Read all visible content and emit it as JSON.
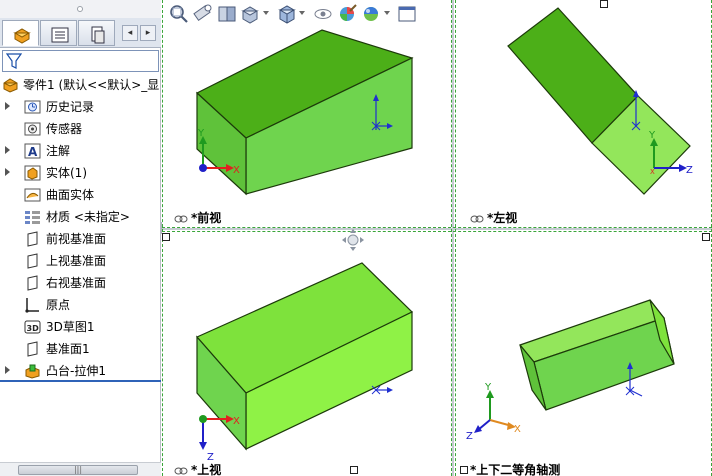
{
  "feature_manager": {
    "root_label": "零件1  (默认<<默认>_显",
    "items": [
      {
        "label": "历史记录",
        "icon": "history-folder-icon",
        "expandable": true
      },
      {
        "label": "传感器",
        "icon": "sensor-folder-icon",
        "expandable": false
      },
      {
        "label": "注解",
        "icon": "annotations-icon",
        "expandable": true
      },
      {
        "label": "实体(1)",
        "icon": "solid-bodies-icon",
        "expandable": true
      },
      {
        "label": "曲面实体",
        "icon": "surface-bodies-icon",
        "expandable": false
      },
      {
        "label": "材质 <未指定>",
        "icon": "material-icon",
        "expandable": false
      },
      {
        "label": "前视基准面",
        "icon": "plane-icon",
        "expandable": false
      },
      {
        "label": "上视基准面",
        "icon": "plane-icon",
        "expandable": false
      },
      {
        "label": "右视基准面",
        "icon": "plane-icon",
        "expandable": false
      },
      {
        "label": "原点",
        "icon": "origin-icon",
        "expandable": false
      },
      {
        "label": "3D草图1",
        "icon": "3d-sketch-icon",
        "expandable": false
      },
      {
        "label": "基准面1",
        "icon": "plane-icon",
        "expandable": false
      },
      {
        "label": "凸台-拉伸1",
        "icon": "boss-extrude-icon",
        "expandable": true
      }
    ]
  },
  "viewports": {
    "front_label": "*前视",
    "left_label": "*左视",
    "top_label": "*上视",
    "trimetric_label": "*上下二等角轴测"
  },
  "triad": {
    "x": "X",
    "y": "Y",
    "z": "Z"
  },
  "colors": {
    "body_top": "#4caf18",
    "body_front": "#6fd44e",
    "body_side": "#93e65b",
    "body_light": "#8ff246",
    "body_mid": "#7ee23c",
    "edge": "#1c3a0a",
    "sketch_blue": "#1f2fd0",
    "axis_red": "#e02020",
    "axis_green": "#1f9a1f",
    "axis_blue": "#2020c8",
    "axis_orange": "#e08a20",
    "split_dash": "#3aa53a"
  }
}
